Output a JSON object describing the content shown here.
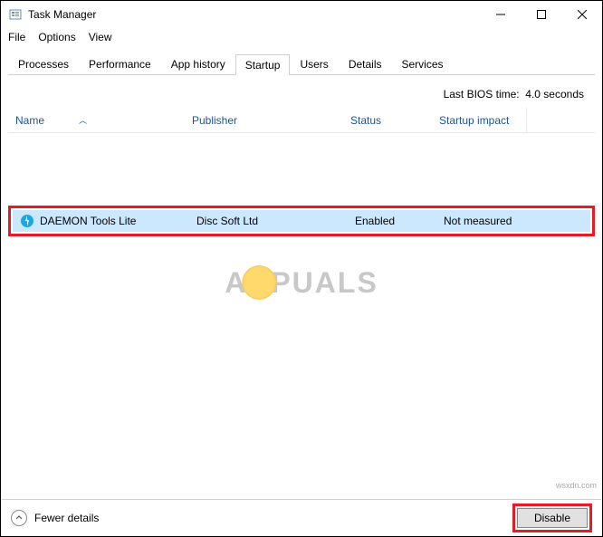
{
  "window": {
    "title": "Task Manager"
  },
  "menubar": {
    "file": "File",
    "options": "Options",
    "view": "View"
  },
  "tabs": {
    "processes": "Processes",
    "performance": "Performance",
    "app_history": "App history",
    "startup": "Startup",
    "users": "Users",
    "details": "Details",
    "services": "Services"
  },
  "bios": {
    "label": "Last BIOS time:",
    "value": "4.0 seconds"
  },
  "columns": {
    "name": "Name",
    "publisher": "Publisher",
    "status": "Status",
    "impact": "Startup impact"
  },
  "rows": [
    {
      "name": "DAEMON Tools Lite",
      "publisher": "Disc Soft Ltd",
      "status": "Enabled",
      "impact": "Not measured"
    }
  ],
  "footer": {
    "fewer_details": "Fewer details",
    "disable": "Disable"
  },
  "watermark": {
    "left": "A",
    "right": "PUALS"
  },
  "attribution": "wsxdn.com"
}
